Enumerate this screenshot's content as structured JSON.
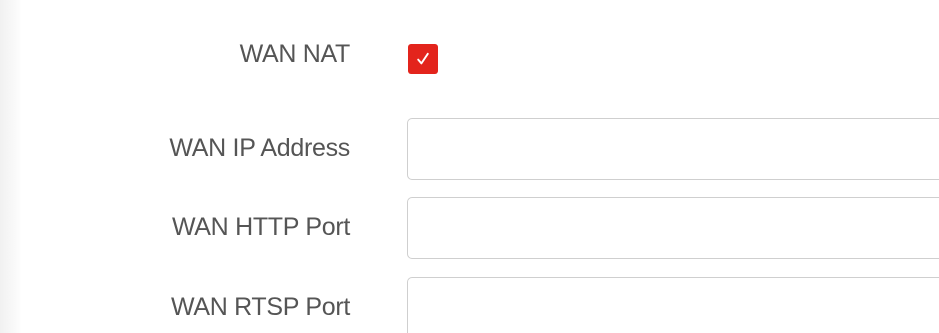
{
  "form": {
    "wan_nat": {
      "label": "WAN NAT",
      "checked": true,
      "check_color": "#e3241c"
    },
    "wan_ip_address": {
      "label": "WAN IP Address",
      "value": "",
      "placeholder": ""
    },
    "wan_http_port": {
      "label": "WAN HTTP Port",
      "value": "",
      "placeholder": ""
    },
    "wan_rtsp_port": {
      "label": "WAN RTSP Port",
      "value": "",
      "placeholder": ""
    }
  },
  "icons": {
    "checkbox": "checkmark-icon"
  }
}
